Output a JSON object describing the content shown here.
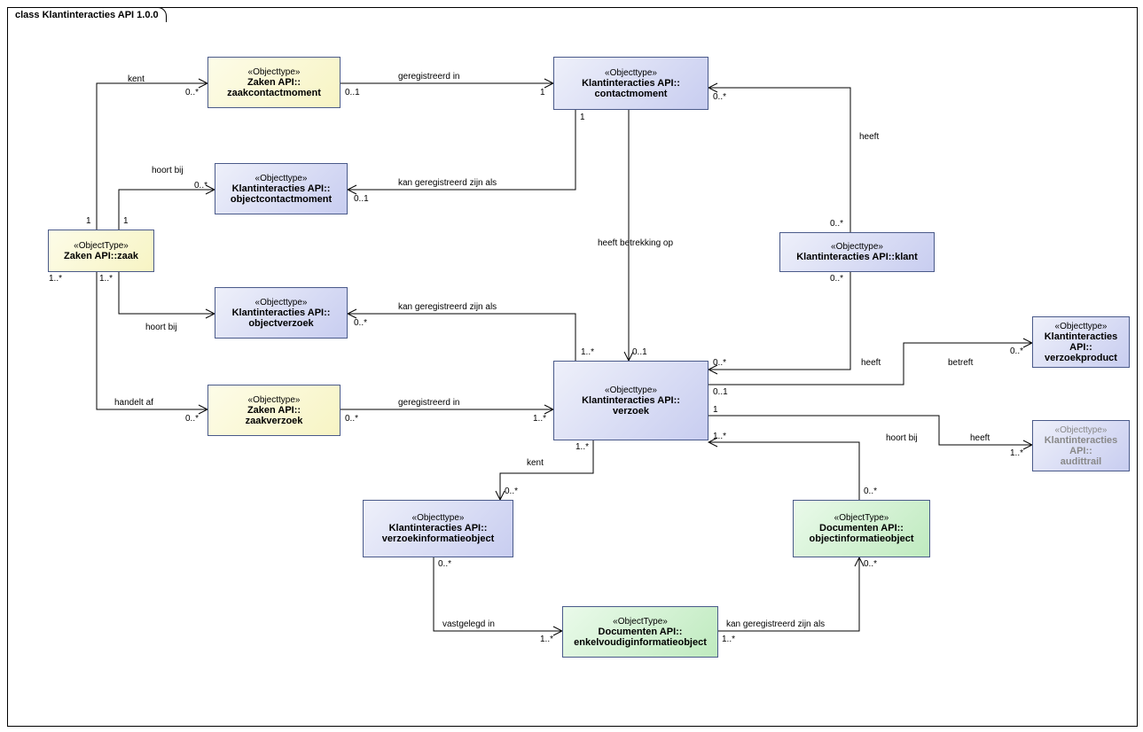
{
  "diagram": {
    "title": "class Klantinteracties API 1.0.0"
  },
  "nodes": {
    "zaak": {
      "stereo": "«ObjectType»",
      "name": "Zaken API::zaak"
    },
    "zaakcontact": {
      "stereo": "«Objecttype»",
      "name": "Zaken API::\nzaakcontactmoment"
    },
    "objcontact": {
      "stereo": "«Objecttype»",
      "name": "Klantinteracties API::\nobjectcontactmoment"
    },
    "contact": {
      "stereo": "«Objecttype»",
      "name": "Klantinteracties API::\ncontactmoment"
    },
    "objverzoek": {
      "stereo": "«Objecttype»",
      "name": "Klantinteracties API::\nobjectverzoek"
    },
    "zaakverzoek": {
      "stereo": "«Objecttype»",
      "name": "Zaken API::\nzaakverzoek"
    },
    "verzoek": {
      "stereo": "«Objecttype»",
      "name": "Klantinteracties API::\nverzoek"
    },
    "klant": {
      "stereo": "«Objecttype»",
      "name": "Klantinteracties API::klant"
    },
    "verzprod": {
      "stereo": "«Objecttype»",
      "name": "Klantinteracties API::\nverzoekproduct"
    },
    "audit": {
      "stereo": "«Objecttype»",
      "name": "Klantinteracties API::\naudittrail"
    },
    "verzinfo": {
      "stereo": "«Objecttype»",
      "name": "Klantinteracties API::\nverzoekinformatieobject"
    },
    "objinfo": {
      "stereo": "«ObjectType»",
      "name": "Documenten API::\nobjectinformatieobject"
    },
    "enkinfo": {
      "stereo": "«ObjectType»",
      "name": "Documenten API::\nenkelvoudiginformatieobject"
    }
  },
  "labels": {
    "kent1": "kent",
    "m0s_a": "0..*",
    "m1_a": "1",
    "gereg1": "geregistreerd in",
    "m01_a": "0..1",
    "m1_b": "1",
    "hoort1": "hoort bij",
    "m0s_b": "0..*",
    "m1_c": "1",
    "kanger1": "kan geregistreerd zijn als",
    "m01_b": "0..1",
    "hoort2": "hoort bij",
    "m1s_a": "1..*",
    "m1s_b": "1..*",
    "kanger2": "kan geregistreerd zijn als",
    "m0s_c": "0..*",
    "handelt": "handelt af",
    "m0s_d": "0..*",
    "m0s_e": "0..*",
    "gereg2": "geregistreerd in",
    "m1s_c": "1..*",
    "betrek": "heeft betrekking op",
    "m1_d": "1",
    "m01_c": "0..1",
    "m1s_d": "1..*",
    "heeft1": "heeft",
    "m0s_f": "0..*",
    "m0s_g": "0..*",
    "heeft2": "heeft",
    "m0s_h": "0..*",
    "m0s_i": "0..*",
    "betreft": "betreft",
    "m01_d": "0..1",
    "m0s_j": "0..*",
    "heeft3": "heeft",
    "m1_e": "1",
    "m1s_e": "1..*",
    "hoort3": "hoort bij",
    "m1s_f": "1..*",
    "m0s_k": "0..*",
    "kent2": "kent",
    "m1s_g": "1..*",
    "m0s_l": "0..*",
    "vastg": "vastgelegd in",
    "m0s_m": "0..*",
    "m1s_h": "1..*",
    "kanger3": "kan geregistreerd zijn als",
    "m1s_i": "1..*",
    "m0s_n": "0..*"
  }
}
